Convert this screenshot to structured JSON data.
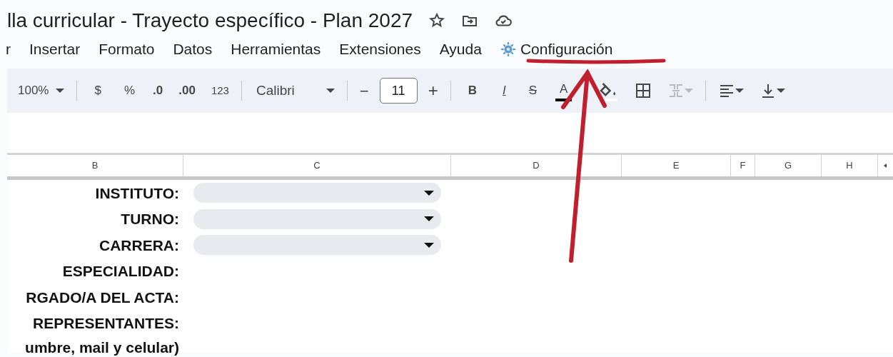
{
  "title": "lla curricular - Trayecto específico - Plan 2027",
  "menu": [
    {
      "label": "r",
      "kind": "plain"
    },
    {
      "label": "Insertar",
      "kind": "plain"
    },
    {
      "label": "Formato",
      "kind": "plain"
    },
    {
      "label": "Datos",
      "kind": "plain"
    },
    {
      "label": "Herramientas",
      "kind": "plain"
    },
    {
      "label": "Extensiones",
      "kind": "plain"
    },
    {
      "label": "Ayuda",
      "kind": "plain"
    },
    {
      "label": "Configuración",
      "kind": "gear"
    }
  ],
  "toolbar": {
    "zoom": "100%",
    "currency": "$",
    "percent": "%",
    "decrease_decimals": ".0",
    "increase_decimals": ".00",
    "number_format": "123",
    "font": "Calibri",
    "minus": "−",
    "font_size": "11",
    "plus": "+",
    "bold": "B",
    "italic": "I",
    "strikethrough": "S",
    "text_color": "A"
  },
  "columns": [
    "B",
    "C",
    "D",
    "E",
    "F",
    "G",
    "H"
  ],
  "rows": [
    {
      "label": "INSTITUTO:",
      "dropdown": true
    },
    {
      "label": "TURNO:",
      "dropdown": true
    },
    {
      "label": "CARRERA:",
      "dropdown": true
    },
    {
      "label": "ESPECIALIDAD:",
      "dropdown": false
    },
    {
      "label": "RGADO/A DEL ACTA:",
      "dropdown": false
    },
    {
      "label": "REPRESENTANTES:",
      "dropdown": false
    },
    {
      "label": "umbre, mail y celular)",
      "dropdown": false
    }
  ]
}
